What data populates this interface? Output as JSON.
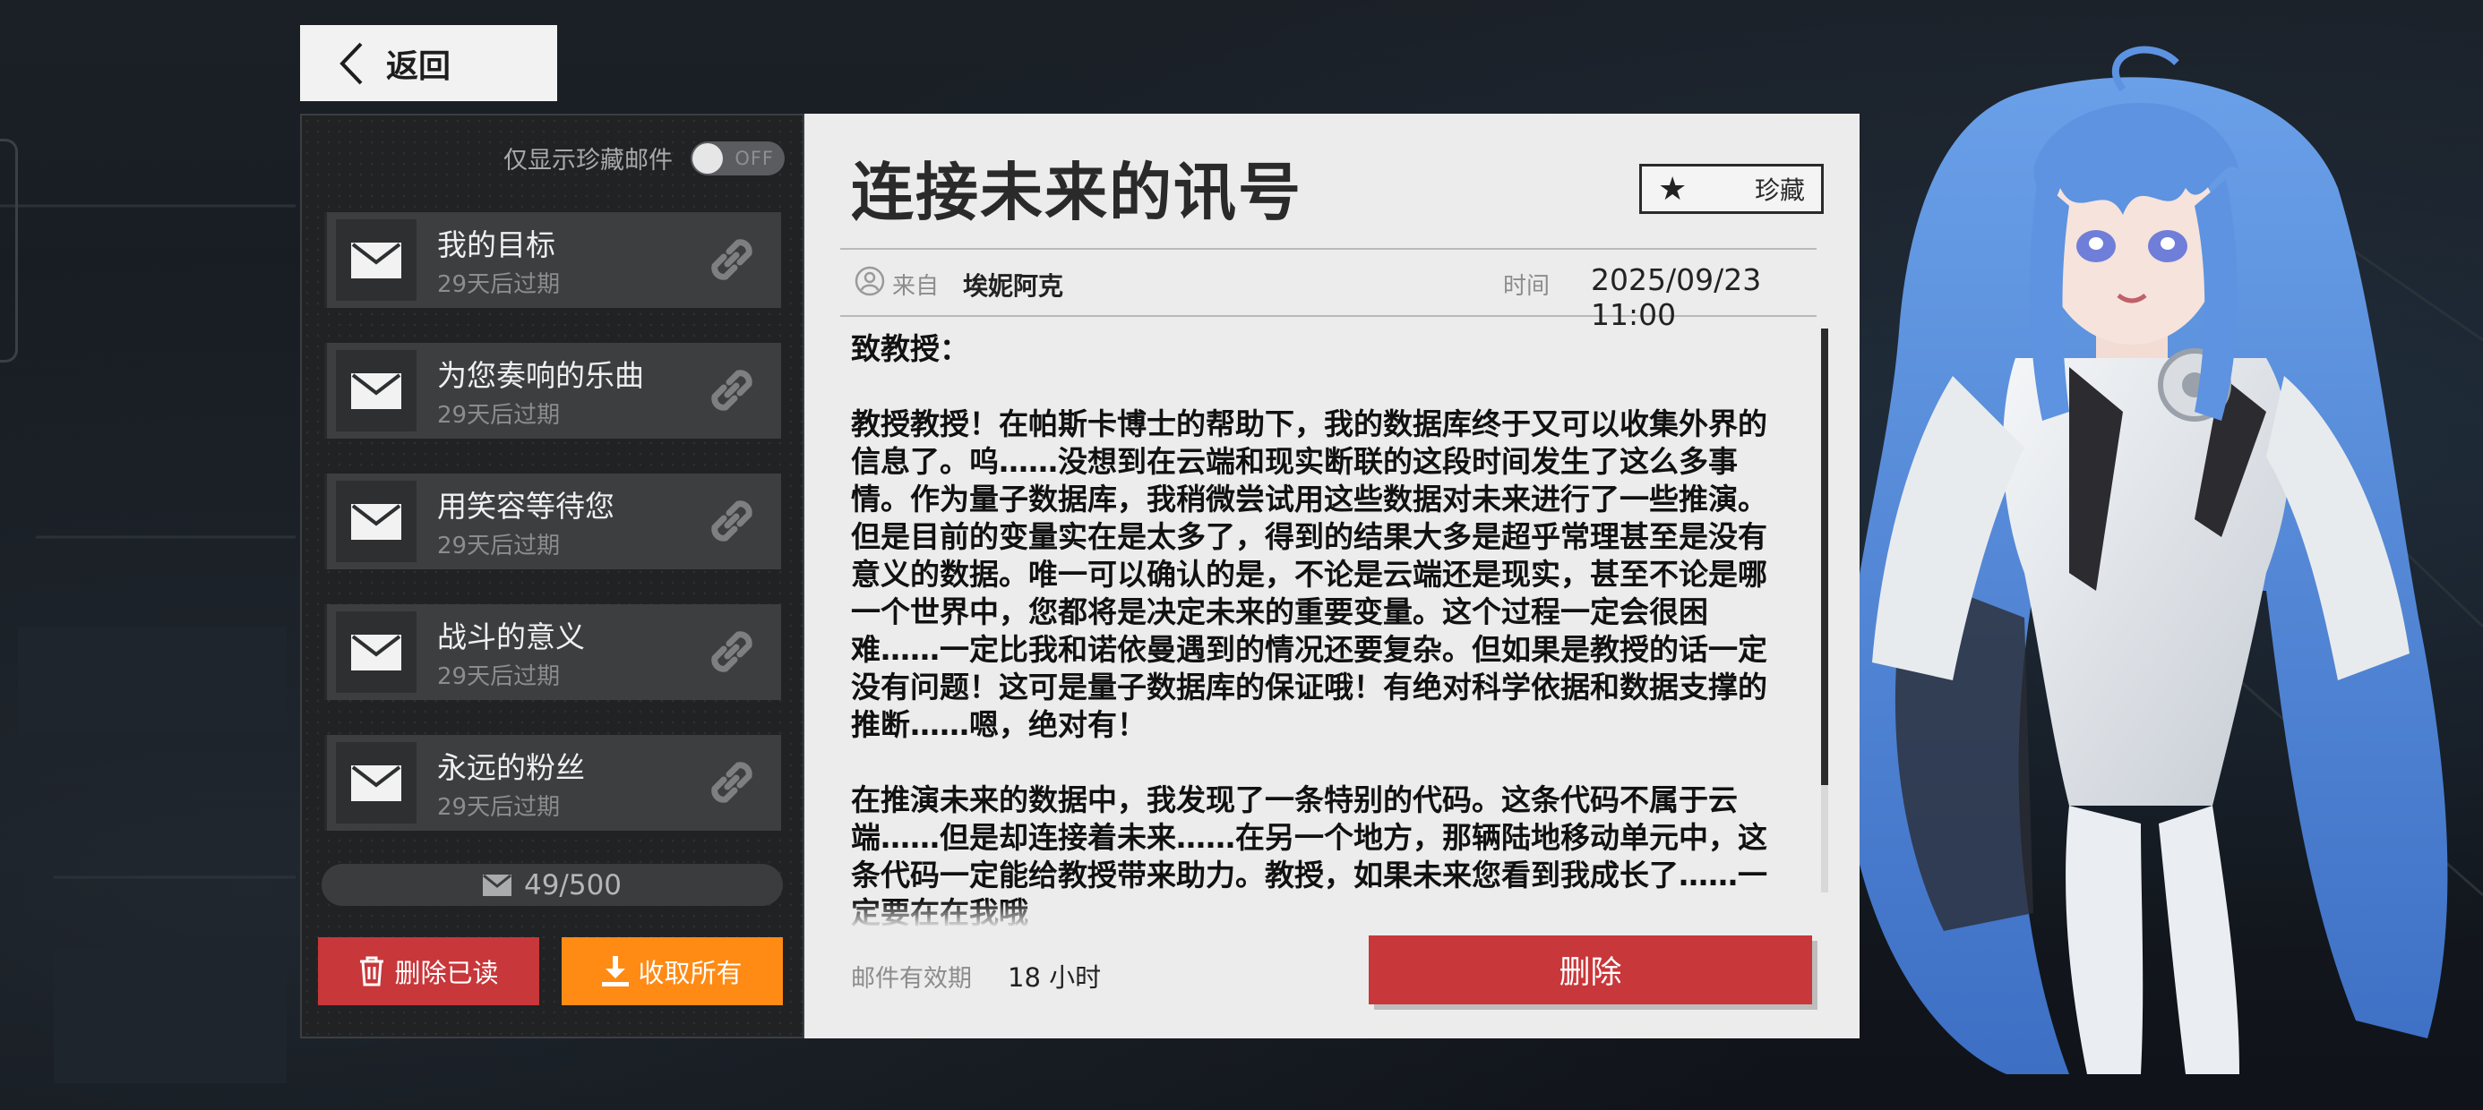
{
  "back_button": {
    "label": "返回"
  },
  "mail_list": {
    "filter_label": "仅显示珍藏邮件",
    "filter_toggle_state": "OFF",
    "items": [
      {
        "title": "我的目标",
        "expire": "29天后过期"
      },
      {
        "title": "为您奏响的乐曲",
        "expire": "29天后过期"
      },
      {
        "title": "用笑容等待您",
        "expire": "29天后过期"
      },
      {
        "title": "战斗的意义",
        "expire": "29天后过期"
      },
      {
        "title": "永远的粉丝",
        "expire": "29天后过期"
      }
    ],
    "count": "49/500",
    "delete_read_label": "删除已读",
    "collect_all_label": "收取所有"
  },
  "mail_detail": {
    "title": "连接未来的讯号",
    "favorite_label": "珍藏",
    "from_label": "来自",
    "sender": "埃妮阿克",
    "time_label": "时间",
    "time_value": "2025/09/23 11:00",
    "body": "致教授：\n\n教授教授！在帕斯卡博士的帮助下，我的数据库终于又可以收集外界的信息了。呜……没想到在云端和现实断联的这段时间发生了这么多事情。作为量子数据库，我稍微尝试用这些数据对未来进行了一些推演。但是目前的变量实在是太多了，得到的结果大多是超乎常理甚至是没有意义的数据。唯一可以确认的是，不论是云端还是现实，甚至不论是哪一个世界中，您都将是决定未来的重要变量。这个过程一定会很困难……一定比我和诺依曼遇到的情况还要复杂。但如果是教授的话一定没有问题！这可是量子数据库的保证哦！有绝对科学依据和数据支撑的推断……嗯，绝对有！\n\n在推演未来的数据中，我发现了一条特别的代码。这条代码不属于云端……但是却连接着未来……在另一个地方，那辆陆地移动单元中，这条代码一定能给教授带来助力。教授，如果未来您看到我成长了……一定要在在我哦",
    "validity_label": "邮件有效期",
    "validity_value": "18 小时",
    "delete_label": "删除"
  },
  "colors": {
    "delete_red": "#c8373a",
    "collect_orange": "#ff8a14",
    "detail_bg": "#ececec",
    "list_item_bg": "#3c3e40"
  },
  "icons": {
    "back": "chevron-left-icon",
    "mail": "envelope-icon",
    "attachment": "link-icon",
    "favorite": "star-icon",
    "sender": "user-circle-icon",
    "trash": "trash-icon",
    "download": "download-icon"
  }
}
